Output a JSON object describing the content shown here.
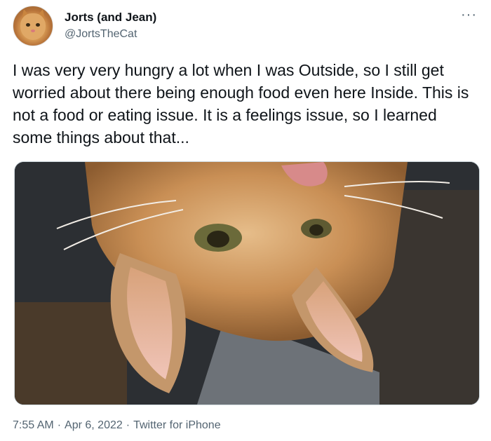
{
  "author": {
    "display_name": "Jorts (and Jean)",
    "handle": "@JortsTheCat",
    "avatar_icon": "cat-avatar-icon"
  },
  "menu_icon": "more-horizontal-icon",
  "tweet_text": "I was very very hungry a lot when I was Outside, so I still get worried about there being enough food even here Inside. This is not a food or eating issue. It is a feelings issue, so I learned some things about that...",
  "media": {
    "kind": "photo",
    "subject": "orange-tabby-cat-upside-down"
  },
  "meta": {
    "time": "7:55 AM",
    "date": "Apr 6, 2022",
    "source": "Twitter for iPhone",
    "separator": "·"
  },
  "colors": {
    "text": "#0f1419",
    "secondary": "#536471",
    "border": "#cfd9de"
  }
}
